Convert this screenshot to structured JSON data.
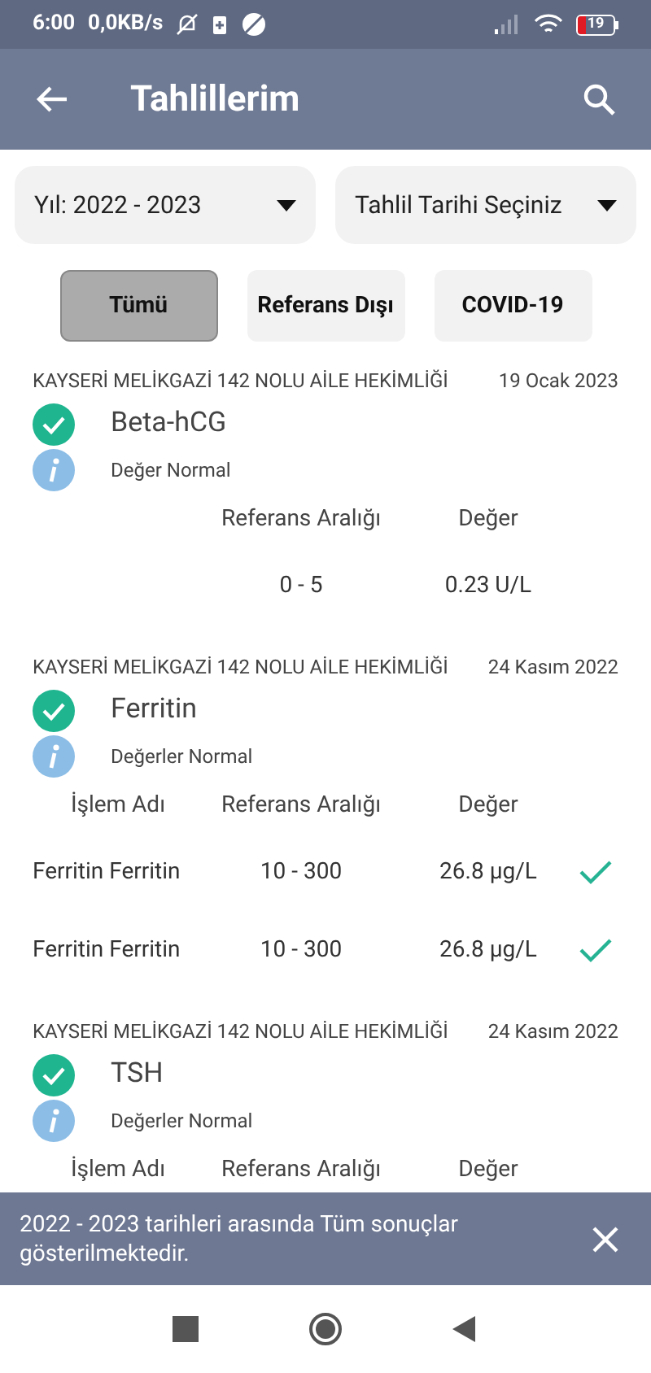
{
  "status_bar": {
    "time": "6:00",
    "speed": "0,0KB/s",
    "battery": "19"
  },
  "app_bar": {
    "title": "Tahlillerim"
  },
  "dropdowns": [
    {
      "label": "Yıl: 2022 - 2023"
    },
    {
      "label": "Tahlil Tarihi Seçiniz"
    }
  ],
  "filters": [
    {
      "label": "Tümü",
      "selected": true
    },
    {
      "label": "Referans Dışı",
      "selected": false
    },
    {
      "label": "COVID-19",
      "selected": false
    }
  ],
  "results": [
    {
      "institution": "KAYSERİ MELİKGAZİ 142 NOLU AİLE HEKİMLİĞİ",
      "date": "19 Ocak 2023",
      "name": "Beta-hCG",
      "status": "Değer Normal",
      "columns": [
        {
          "kind": "range",
          "label": "Referans Aralığı"
        },
        {
          "kind": "value",
          "label": "Değer"
        }
      ],
      "rows": [
        {
          "range": "0 - 5",
          "value": "0.23 U/L",
          "checked": false
        }
      ]
    },
    {
      "institution": "KAYSERİ MELİKGAZİ 142 NOLU AİLE HEKİMLİĞİ",
      "date": "24 Kasım 2022",
      "name": "Ferritin",
      "status": "Değerler Normal",
      "columns": [
        {
          "kind": "name",
          "label": "İşlem Adı"
        },
        {
          "kind": "range",
          "label": "Referans Aralığı"
        },
        {
          "kind": "value",
          "label": "Değer"
        }
      ],
      "rows": [
        {
          "name": "Ferritin Ferritin",
          "range": "10 - 300",
          "value": "26.8 µg/L",
          "checked": true
        },
        {
          "name": "Ferritin Ferritin",
          "range": "10 - 300",
          "value": "26.8 µg/L",
          "checked": true
        }
      ]
    },
    {
      "institution": "KAYSERİ MELİKGAZİ 142 NOLU AİLE HEKİMLİĞİ",
      "date": "24 Kasım 2022",
      "name": "TSH",
      "status": "Değerler Normal",
      "columns": [
        {
          "kind": "name",
          "label": "İşlem Adı"
        },
        {
          "kind": "range",
          "label": "Referans Aralığı"
        },
        {
          "kind": "value",
          "label": "Değer"
        }
      ]
    }
  ],
  "snackbar": {
    "message": "2022 - 2023 tarihleri arasında Tüm sonuçlar gösterilmektedir."
  }
}
